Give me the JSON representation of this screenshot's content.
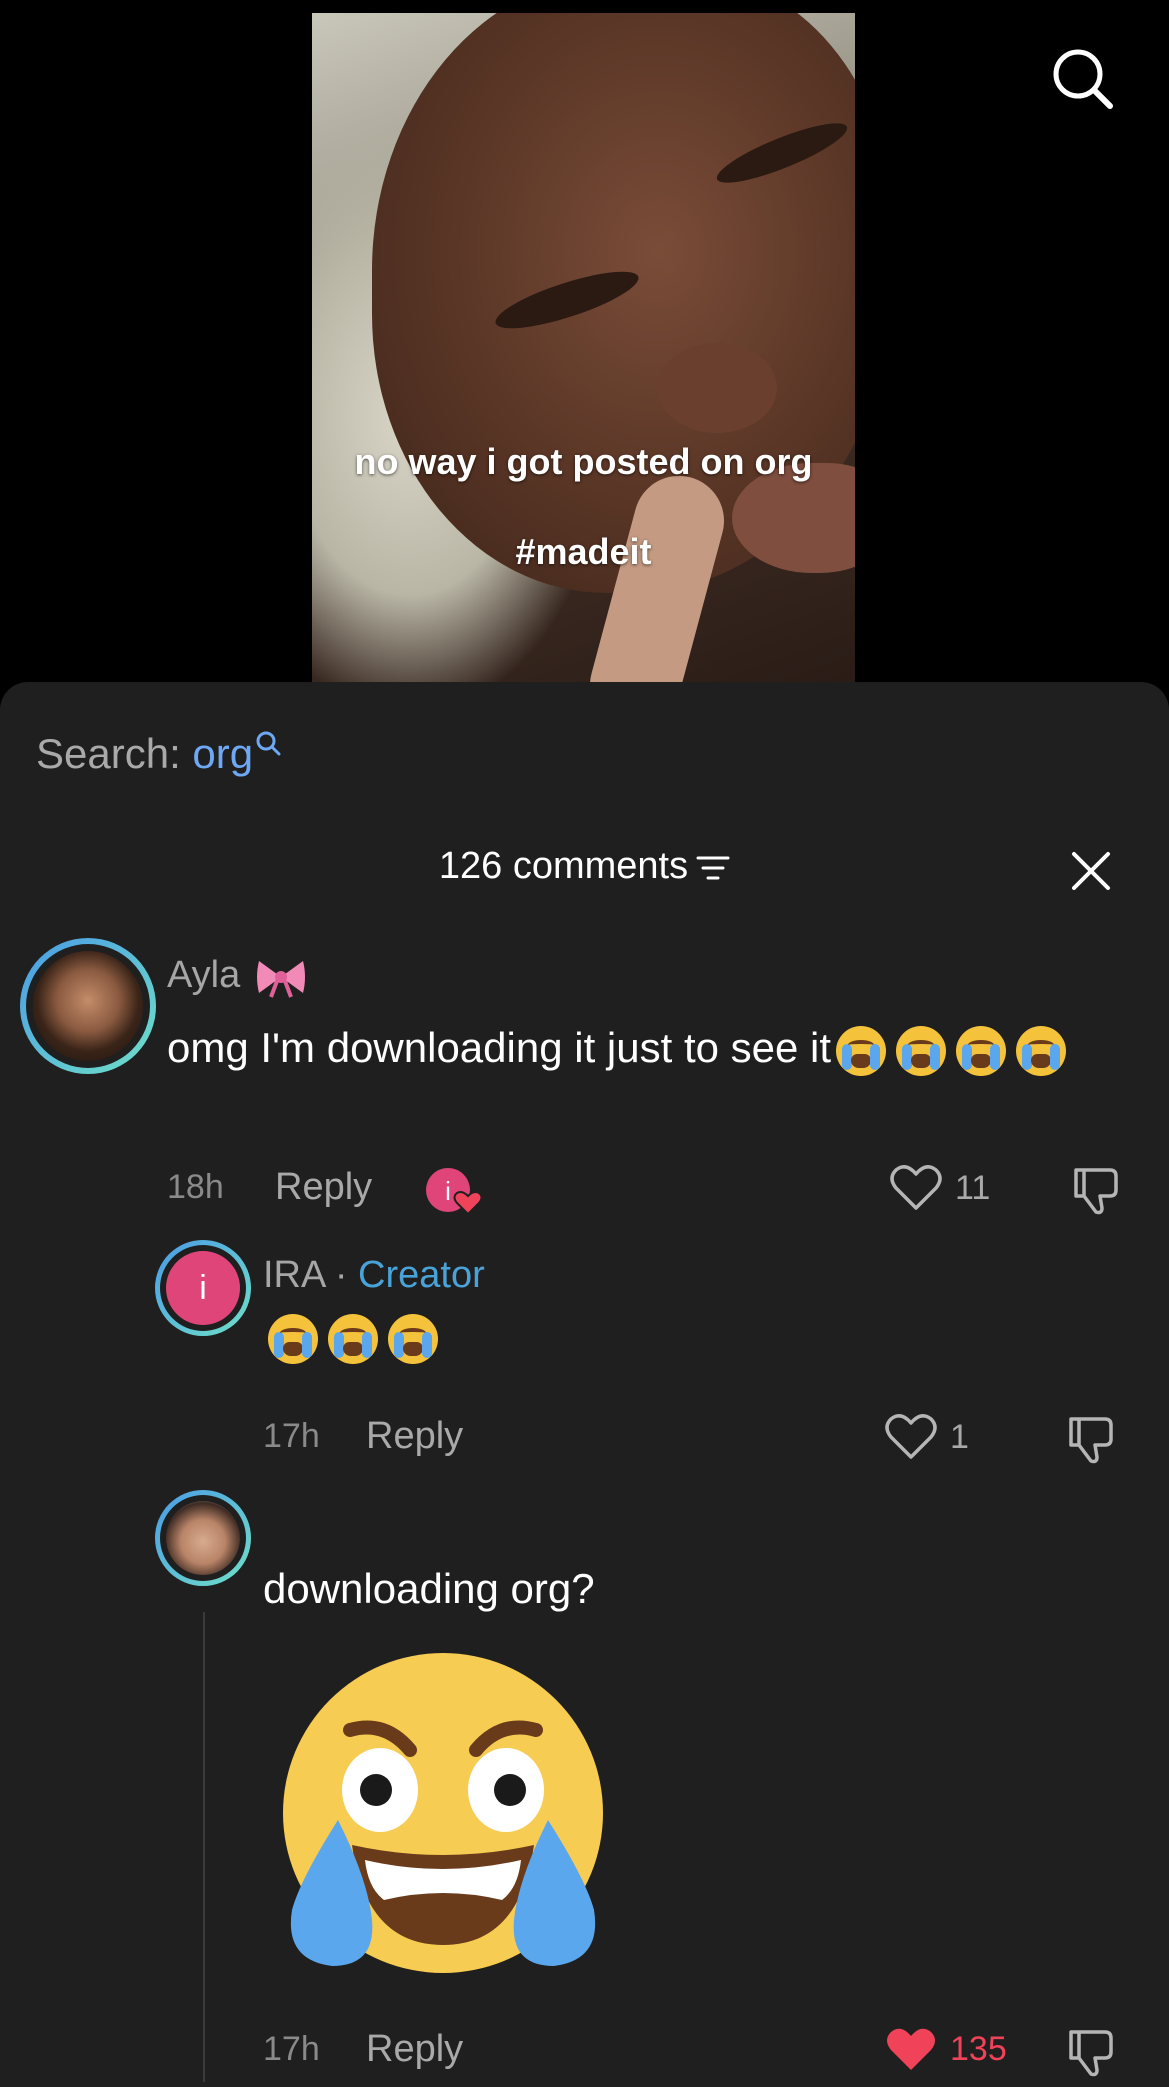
{
  "video": {
    "caption_line1": "no way i got posted on org",
    "caption_line2": "#madeit"
  },
  "search": {
    "label": "Search:",
    "term": "org"
  },
  "comments_header": {
    "title": "126 comments"
  },
  "comments": [
    {
      "author": "Ayla",
      "author_suffix_icon": "bow-icon",
      "text": "omg I'm downloading it just to see it",
      "time": "18h",
      "reply_label": "Reply",
      "likes": "11",
      "liked_by_creator": true
    },
    {
      "author": "IRA",
      "separator": "·",
      "author_badge": "Creator",
      "avatar_initial": "i",
      "time": "17h",
      "reply_label": "Reply",
      "likes": "1"
    },
    {
      "author": "",
      "text": "downloading org?",
      "sticker": "laughing-crying-face",
      "time": "17h",
      "reply_label": "Reply",
      "likes": "135",
      "liked": true
    }
  ],
  "colors": {
    "sheet_bg": "#1f1f1f",
    "link_blue": "#6ea8f5",
    "creator_blue": "#4aa3d8",
    "like_red": "#f0435a"
  }
}
